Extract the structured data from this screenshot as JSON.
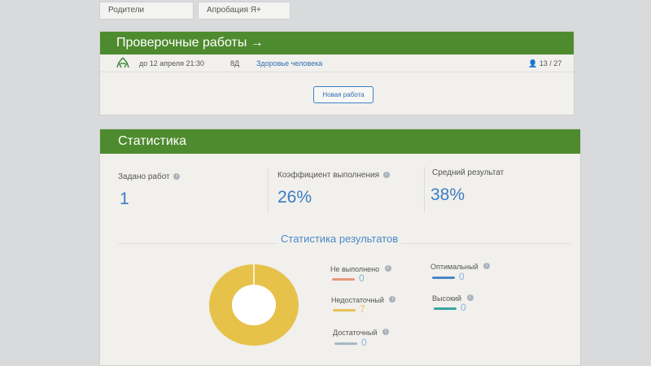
{
  "tabs": [
    "Родители",
    "Апробация Я+"
  ],
  "tests_panel": {
    "title": "Проверочные работы →",
    "row": {
      "deadline": "до 12 апреля  21:30",
      "class": "8Д",
      "subject": "Здоровье человека",
      "count": "13 / 27"
    },
    "new_button": "Новая работа"
  },
  "stats_panel": {
    "title": "Статистика",
    "assigned_label": "Задано работ",
    "assigned_value": "1",
    "completion_label": "Коэффициент выполнения",
    "completion_value": "26%",
    "avg_label": "Средний результат",
    "avg_value": "38%",
    "results_title": "Статистика результатов",
    "legend": [
      {
        "label": "Не выполнено",
        "value": "0",
        "color": "#e9967a"
      },
      {
        "label": "Оптимальный",
        "value": "0",
        "color": "#4a86c5"
      },
      {
        "label": "Недостаточный",
        "value": "7",
        "color": "#e8c25a"
      },
      {
        "label": "Высокий",
        "value": "0",
        "color": "#3aa3a3"
      },
      {
        "label": "Достаточный",
        "value": "0",
        "color": "#a9b6c8"
      }
    ]
  },
  "donut": {
    "color": "#e7c24a",
    "center_color": "#ffffff",
    "fraction": 1
  }
}
